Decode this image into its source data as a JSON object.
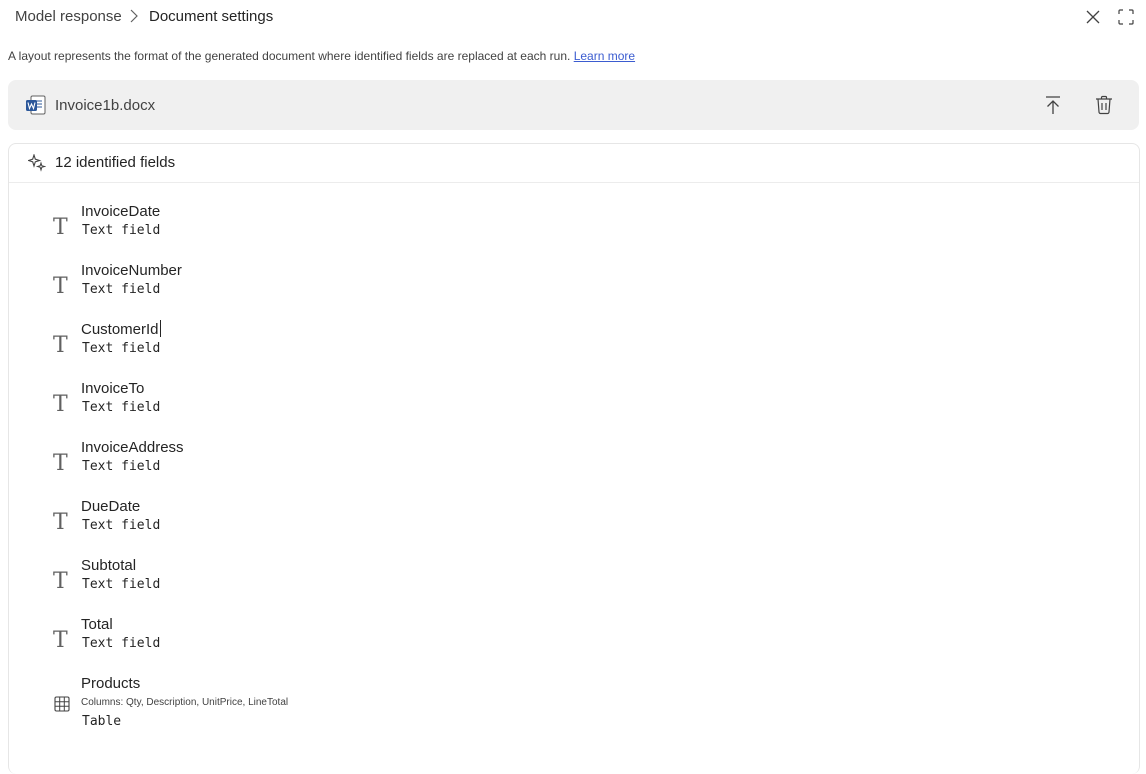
{
  "header": {
    "breadcrumb_root": "Model response",
    "breadcrumb_current": "Document settings",
    "close_icon": "close-icon",
    "expand_icon": "expand-icon"
  },
  "description": {
    "text": "A layout represents the format of the generated document where identified fields are replaced at each run.",
    "link": "Learn more"
  },
  "file": {
    "name": "Invoice1b.docx",
    "icon": "word-file-icon",
    "upload_icon": "upload-icon",
    "delete_icon": "delete-icon"
  },
  "fields_panel": {
    "title": "12 identified fields",
    "icon": "sparkle-icon",
    "fields": [
      {
        "name": "InvoiceDate",
        "type": "Text field"
      },
      {
        "name": "InvoiceNumber",
        "type": "Text field"
      },
      {
        "name": "CustomerId",
        "type": "Text field"
      },
      {
        "name": "InvoiceTo",
        "type": "Text field"
      },
      {
        "name": "InvoiceAddress",
        "type": "Text field"
      },
      {
        "name": "DueDate",
        "type": "Text field"
      },
      {
        "name": "Subtotal",
        "type": "Text field"
      },
      {
        "name": "Total",
        "type": "Text field"
      }
    ],
    "table_field": {
      "name": "Products",
      "columns": "Columns: Qty, Description, UnitPrice, LineTotal",
      "type": "Table"
    },
    "colors": {
      "text": "#242424",
      "link": "#3b5cd0",
      "filebar_bg": "#f0f0f0"
    }
  }
}
